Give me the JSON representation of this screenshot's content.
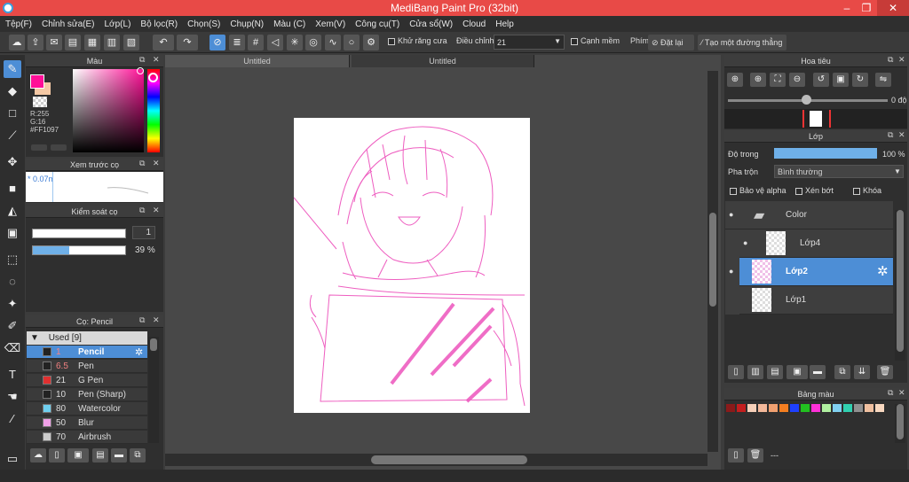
{
  "window": {
    "title": "MediBang Paint Pro (32bit)",
    "minimize": "–",
    "restore": "❐",
    "close": "✕"
  },
  "menu": [
    "Tệp(F)",
    "Chỉnh sửa(E)",
    "Lớp(L)",
    "Bộ lọc(R)",
    "Chọn(S)",
    "Chụp(N)",
    "Màu (C)",
    "Xem(V)",
    "Công cụ(T)",
    "Cửa sổ(W)",
    "Cloud",
    "Help"
  ],
  "toolbar": {
    "antialias_label": "Khử răng cưa",
    "adjust_label": "Điều chỉnh",
    "adjust_value": "21",
    "smooth_label": "Cạnh mềm",
    "key_label": "Phím",
    "reset_label": "Đặt lại",
    "newline_label": "Tạo một đường thẳng"
  },
  "color_panel": {
    "title": "Màu",
    "r": "R:255",
    "g": "G:16",
    "hex": "#FF1097",
    "primary": "#ff1097",
    "secondary": "#f5c9a5"
  },
  "brush_preview": {
    "title": "Xem trước cọ",
    "size": "* 0.07mm"
  },
  "brush_control": {
    "title": "Kiểm soát cọ",
    "size": "1",
    "opacity": "39 %",
    "opacity_fraction": 0.39
  },
  "brush_list": {
    "title": "Cọ: Pencil",
    "group": "Used [9]",
    "items": [
      {
        "size": "1",
        "name": "Pencil",
        "color": "#222222",
        "selected": true
      },
      {
        "size": "6.5",
        "name": "Pen",
        "color": "#222222",
        "selected": false
      },
      {
        "size": "21",
        "name": "G Pen",
        "color": "#e03030",
        "selected": false
      },
      {
        "size": "10",
        "name": "Pen (Sharp)",
        "color": "#222222",
        "selected": false
      },
      {
        "size": "80",
        "name": "Watercolor",
        "color": "#6fd0f0",
        "selected": false
      },
      {
        "size": "50",
        "name": "Blur",
        "color": "#f0a0e8",
        "selected": false
      },
      {
        "size": "70",
        "name": "Airbrush",
        "color": "#cccccc",
        "selected": false
      }
    ]
  },
  "documents": [
    {
      "title": "Untitled"
    },
    {
      "title": "Untitled"
    }
  ],
  "navigator": {
    "title": "Hoa tiêu",
    "angle": "0 độ"
  },
  "layers": {
    "title": "Lớp",
    "opacity_label": "Độ trong",
    "opacity_value": "100 %",
    "blend_label": "Pha trộn",
    "blend_value": "Bình thường",
    "alpha_label": "Bảo vệ alpha",
    "clip_label": "Xén bớt",
    "lock_label": "Khóa",
    "items": [
      {
        "name": "Color",
        "type": "folder"
      },
      {
        "name": "Lớp4",
        "type": "layer"
      },
      {
        "name": "Lớp2",
        "type": "layer",
        "selected": true
      },
      {
        "name": "Lớp1",
        "type": "layer"
      }
    ]
  },
  "palette": {
    "title": "Bảng màu",
    "status": "---",
    "colors": [
      "#8b1a1a",
      "#c41e1e",
      "#f6cfb8",
      "#f3b89a",
      "#f0a070",
      "#f47e20",
      "#1e40ff",
      "#22c020",
      "#ff30d8",
      "#b0f0a0",
      "#80d0f0",
      "#30d0b0",
      "#909090",
      "#f0c0a0",
      "#f8d8c0"
    ]
  }
}
